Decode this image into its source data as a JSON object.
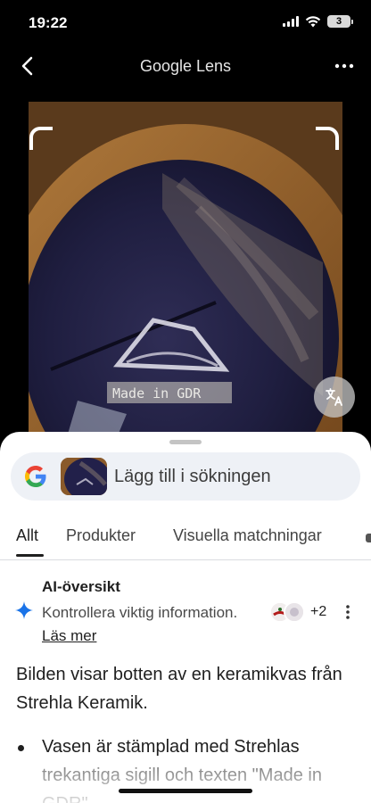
{
  "status_bar": {
    "time": "19:22",
    "battery": "3"
  },
  "header": {
    "title": "Google Lens"
  },
  "search": {
    "label": "Lägg till i sökningen"
  },
  "tabs": [
    {
      "label": "Allt",
      "selected": true
    },
    {
      "label": "Produkter",
      "selected": false
    },
    {
      "label": "Visuella matchningar",
      "selected": false
    }
  ],
  "ai_overview": {
    "heading": "AI-översikt",
    "notice": "Kontrollera viktig information.",
    "link": "Läs mer",
    "sources_more": "+2"
  },
  "result": {
    "summary": "Bilden visar botten av en keramikvas från Strehla Keramik.",
    "bullet": "Vasen är stämplad med Strehlas trekantiga sigill och texten \"Made in GDR\""
  },
  "photo": {
    "stamp_text": "Made in GDR"
  },
  "colors": {
    "accent_blue": "#1a73e8",
    "sheet_bg": "#ffffff",
    "pill_bg": "#eef1f6"
  }
}
